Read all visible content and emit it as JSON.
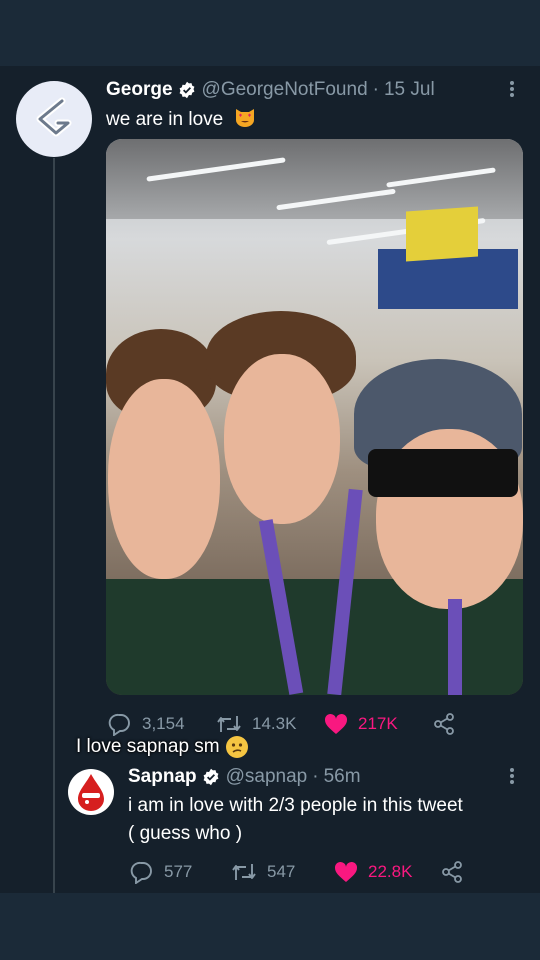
{
  "tweet1": {
    "name": "George",
    "handle": "@GeorgeNotFound",
    "separator": "·",
    "date": "15 Jul",
    "text": "we are in love",
    "emoji": "smiling-cat-heart-eyes",
    "replies": "3,154",
    "retweets": "14.3K",
    "likes": "217K"
  },
  "caption": {
    "text": "I love sapnap sm",
    "emoji": "confused-face"
  },
  "tweet2": {
    "name": "Sapnap",
    "handle": "@sapnap",
    "separator": "·",
    "time": "56m",
    "text_line1": "i am in love with 2/3 people in this tweet",
    "text_line2": "( guess who )",
    "replies": "577",
    "retweets": "547",
    "likes": "22.8K"
  },
  "colors": {
    "background": "#15202b",
    "band": "#1b2a38",
    "muted": "#8899a6",
    "like": "#f91880",
    "verified": "#ffffff"
  },
  "icons": [
    "verified-badge-icon",
    "more-options-icon",
    "reply-icon",
    "retweet-icon",
    "heart-icon",
    "share-icon"
  ]
}
